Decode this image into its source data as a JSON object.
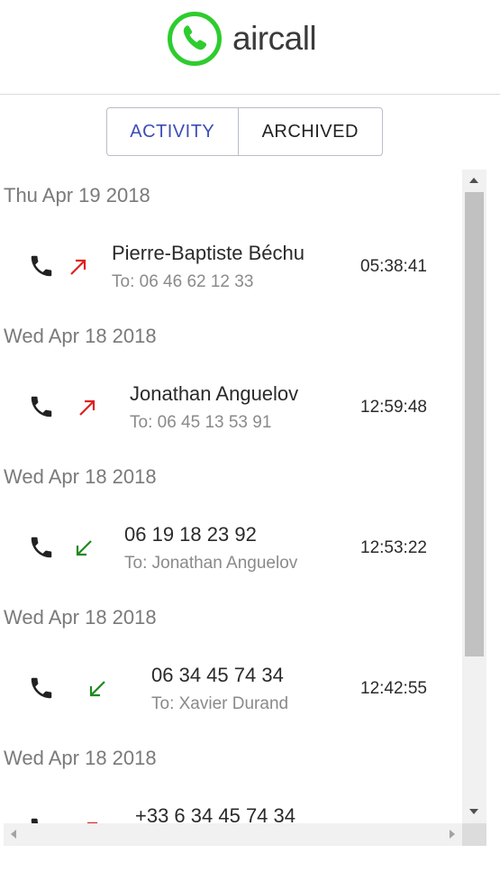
{
  "brand": {
    "name": "aircall",
    "color": "#2ecc2e"
  },
  "tabs": [
    {
      "label": "ACTIVITY",
      "active": true
    },
    {
      "label": "ARCHIVED",
      "active": false
    }
  ],
  "colors": {
    "outgoing": "#e02020",
    "incoming": "#1e8a1e",
    "tab_active": "#3d4db7"
  },
  "calls": [
    {
      "date": "Thu Apr 19 2018",
      "direction": "outgoing",
      "icon": "arrow-up-right-icon",
      "name": "Pierre-Baptiste Béchu",
      "sub": "To: 06 46 62 12 33",
      "time": "05:38:41"
    },
    {
      "date": "Wed Apr 18 2018",
      "direction": "outgoing",
      "icon": "arrow-up-right-icon",
      "name": "Jonathan Anguelov",
      "sub": "To: 06 45 13 53 91",
      "time": "12:59:48"
    },
    {
      "date": "Wed Apr 18 2018",
      "direction": "incoming",
      "icon": "arrow-down-left-icon",
      "name": "06 19 18 23 92",
      "sub": "To: Jonathan Anguelov",
      "time": "12:53:22"
    },
    {
      "date": "Wed Apr 18 2018",
      "direction": "incoming",
      "icon": "arrow-down-left-icon",
      "name": "06 34 45 74 34",
      "sub": "To: Xavier Durand",
      "time": "12:42:55"
    },
    {
      "date": "Wed Apr 18 2018",
      "direction": "outgoing",
      "icon": "arrow-up-right-icon",
      "name": "+33 6 34 45 74 34",
      "sub": "",
      "time": ""
    }
  ]
}
